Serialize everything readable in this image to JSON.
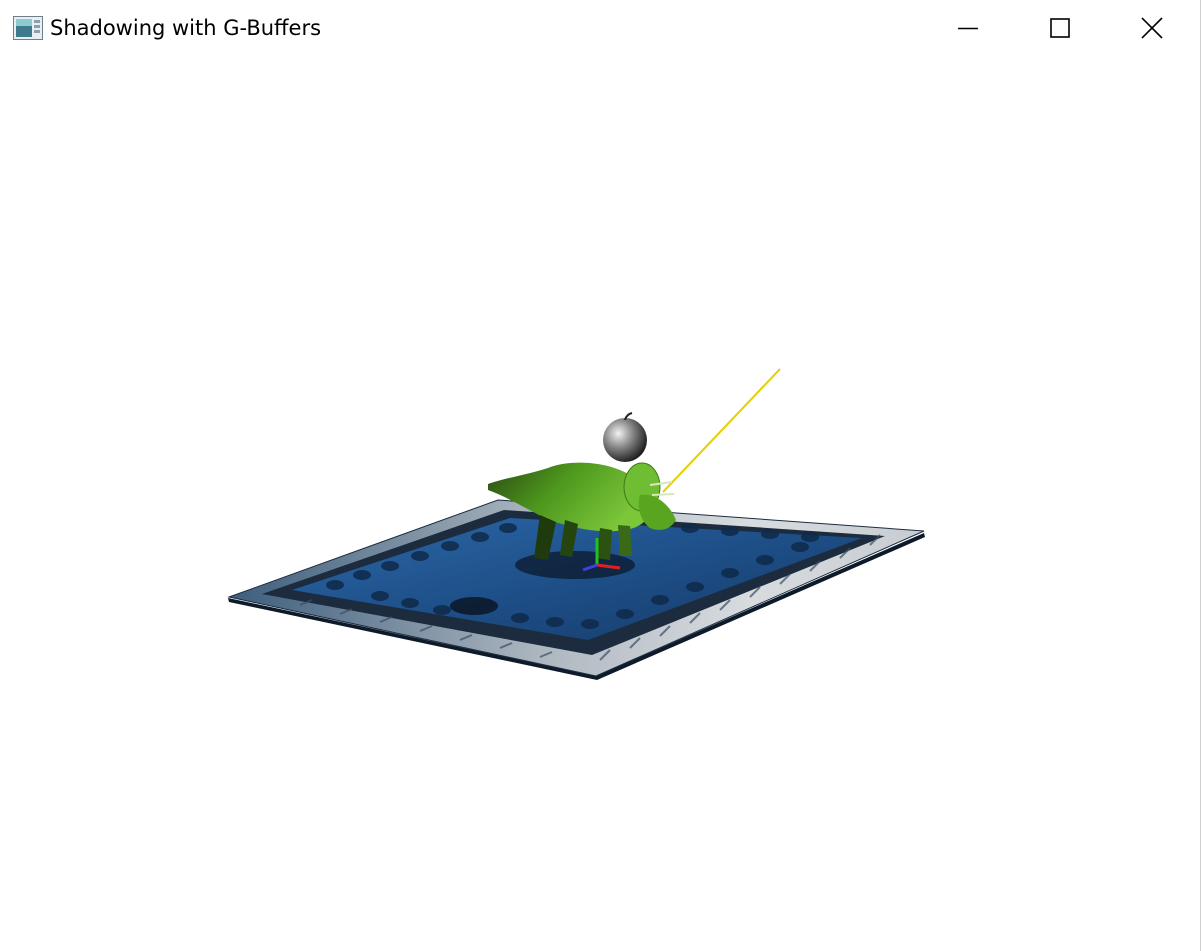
{
  "window": {
    "title": "Shadowing with G-Buffers",
    "icon": "application-icon",
    "controls": {
      "minimize": "minimize-icon",
      "maximize": "maximize-icon",
      "close": "close-icon"
    }
  },
  "scene": {
    "background_color": "#ffffff",
    "objects": [
      "rug",
      "triceratops",
      "apple",
      "light-ray",
      "axis-gizmo"
    ],
    "colors": {
      "rug_blue": "#1f4f86",
      "rug_border": "#cfd3d8",
      "dinosaur_green": "#4f9a1e",
      "light_ray": "#e6d000",
      "axis_x": "#e02020",
      "axis_y": "#20c020",
      "axis_z": "#4040e0"
    }
  }
}
